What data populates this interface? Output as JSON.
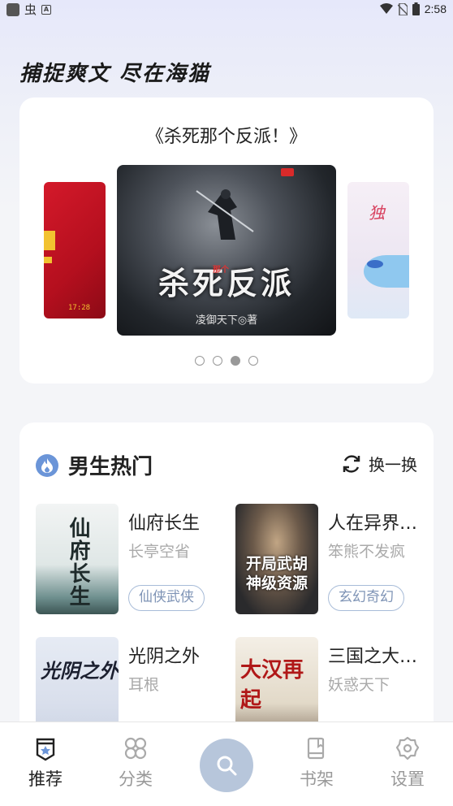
{
  "status_bar": {
    "time": "2:58"
  },
  "slogan": "捕捉爽文 尽在海猫",
  "banner": {
    "title": "《杀死那个反派！》",
    "main_cover": {
      "title_big": "杀死反派",
      "title_small": "那个",
      "author": "凌御天下◎著"
    },
    "left_cover": {
      "tag": "17:28"
    },
    "right_cover": {
      "char": "独"
    },
    "dots": 4,
    "active_dot": 2
  },
  "hot_section": {
    "title": "男生热门",
    "refresh_label": "换一换",
    "books": [
      {
        "title": "仙府长生",
        "author": "长亭空省",
        "tag": "仙侠武侠",
        "cover_text": "仙府长生"
      },
      {
        "title": "人在异界…",
        "author": "笨熊不发疯",
        "tag": "玄幻奇幻",
        "cover_text": "开局武胡神级资源"
      },
      {
        "title": "光阴之外",
        "author": "耳根",
        "tag": "",
        "cover_text": "光阴之外"
      },
      {
        "title": "三国之大…",
        "author": "妖惑天下",
        "tag": "",
        "cover_text": "大汉再起"
      }
    ]
  },
  "bottom_nav": {
    "items": [
      {
        "label": "推荐",
        "icon": "recommend-icon",
        "active": true
      },
      {
        "label": "分类",
        "icon": "category-icon",
        "active": false
      },
      {
        "label": "书架",
        "icon": "bookshelf-icon",
        "active": false
      },
      {
        "label": "设置",
        "icon": "settings-icon",
        "active": false
      }
    ],
    "search_icon": "search-icon"
  },
  "colors": {
    "accent": "#6b95d8",
    "tag_border": "#a8bcd8",
    "fab": "#b7c6db"
  }
}
